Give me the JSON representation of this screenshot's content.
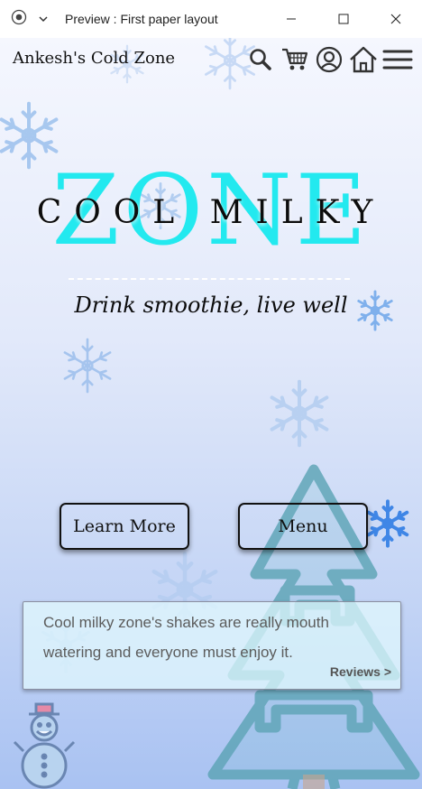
{
  "window": {
    "title": "Preview : First paper layout"
  },
  "navbar": {
    "brand": "Ankesh's Cold Zone",
    "icons": [
      "search-icon",
      "cart-icon",
      "user-icon",
      "home-icon",
      "menu-icon"
    ]
  },
  "hero": {
    "zone": "ZONE",
    "cool_milky": "COOL MILKY",
    "tagline": "Drink smoothie, live well"
  },
  "buttons": {
    "learn_more": "Learn More",
    "menu": "Menu"
  },
  "review": {
    "text": "Cool milky zone's shakes are really mouth watering and everyone must enjoy it.",
    "link": "Reviews >"
  },
  "colors": {
    "zone_cyan": "#23e9ef",
    "snow_blue": "#6fa8ee",
    "tree_teal": "#5aa3b4",
    "bg_bottom": "#a9c2f2"
  }
}
